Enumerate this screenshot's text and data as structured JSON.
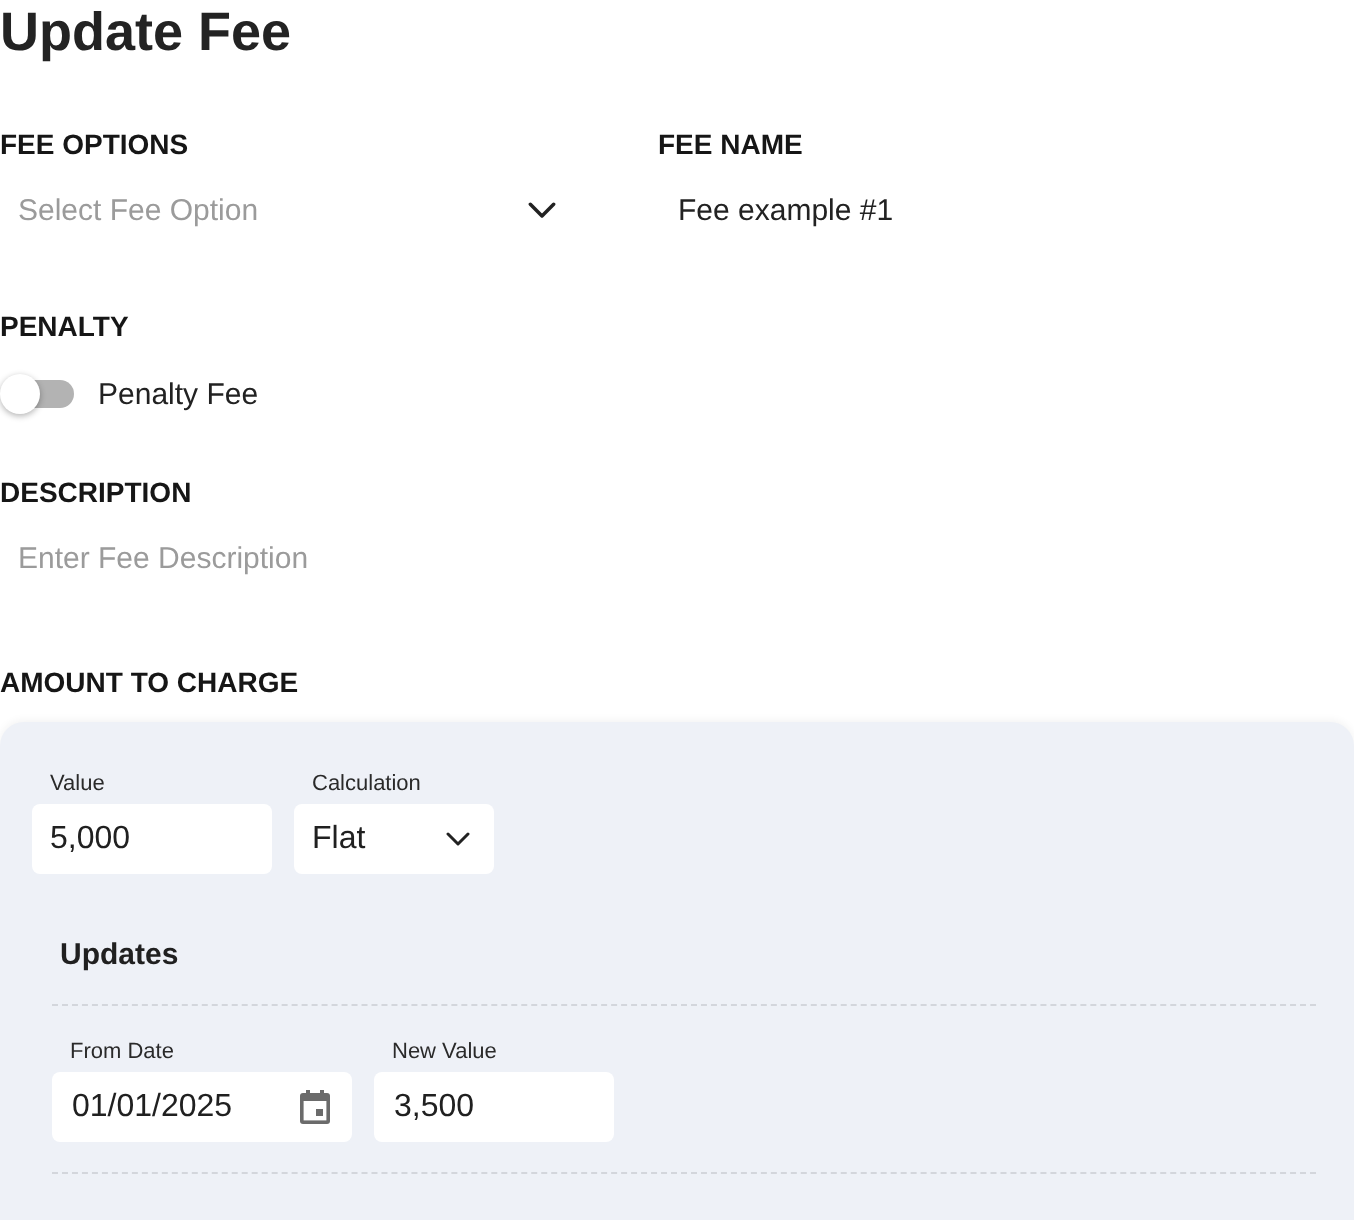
{
  "title": "Update Fee",
  "fee_options": {
    "label": "FEE OPTIONS",
    "placeholder": "Select Fee Option"
  },
  "fee_name": {
    "label": "FEE NAME",
    "value": "Fee example #1"
  },
  "penalty": {
    "label": "PENALTY",
    "toggle": {
      "label": "Penalty Fee",
      "on": false
    }
  },
  "description": {
    "label": "DESCRIPTION",
    "placeholder": "Enter Fee Description"
  },
  "amount_to_charge": {
    "label": "AMOUNT TO CHARGE",
    "value": {
      "label": "Value",
      "value": "5,000"
    },
    "calculation": {
      "label": "Calculation",
      "value": "Flat"
    },
    "updates": {
      "title": "Updates",
      "rows": [
        {
          "from_date": {
            "label": "From Date",
            "value": "01/01/2025"
          },
          "new_value": {
            "label": "New Value",
            "value": "3,500"
          }
        }
      ]
    }
  }
}
